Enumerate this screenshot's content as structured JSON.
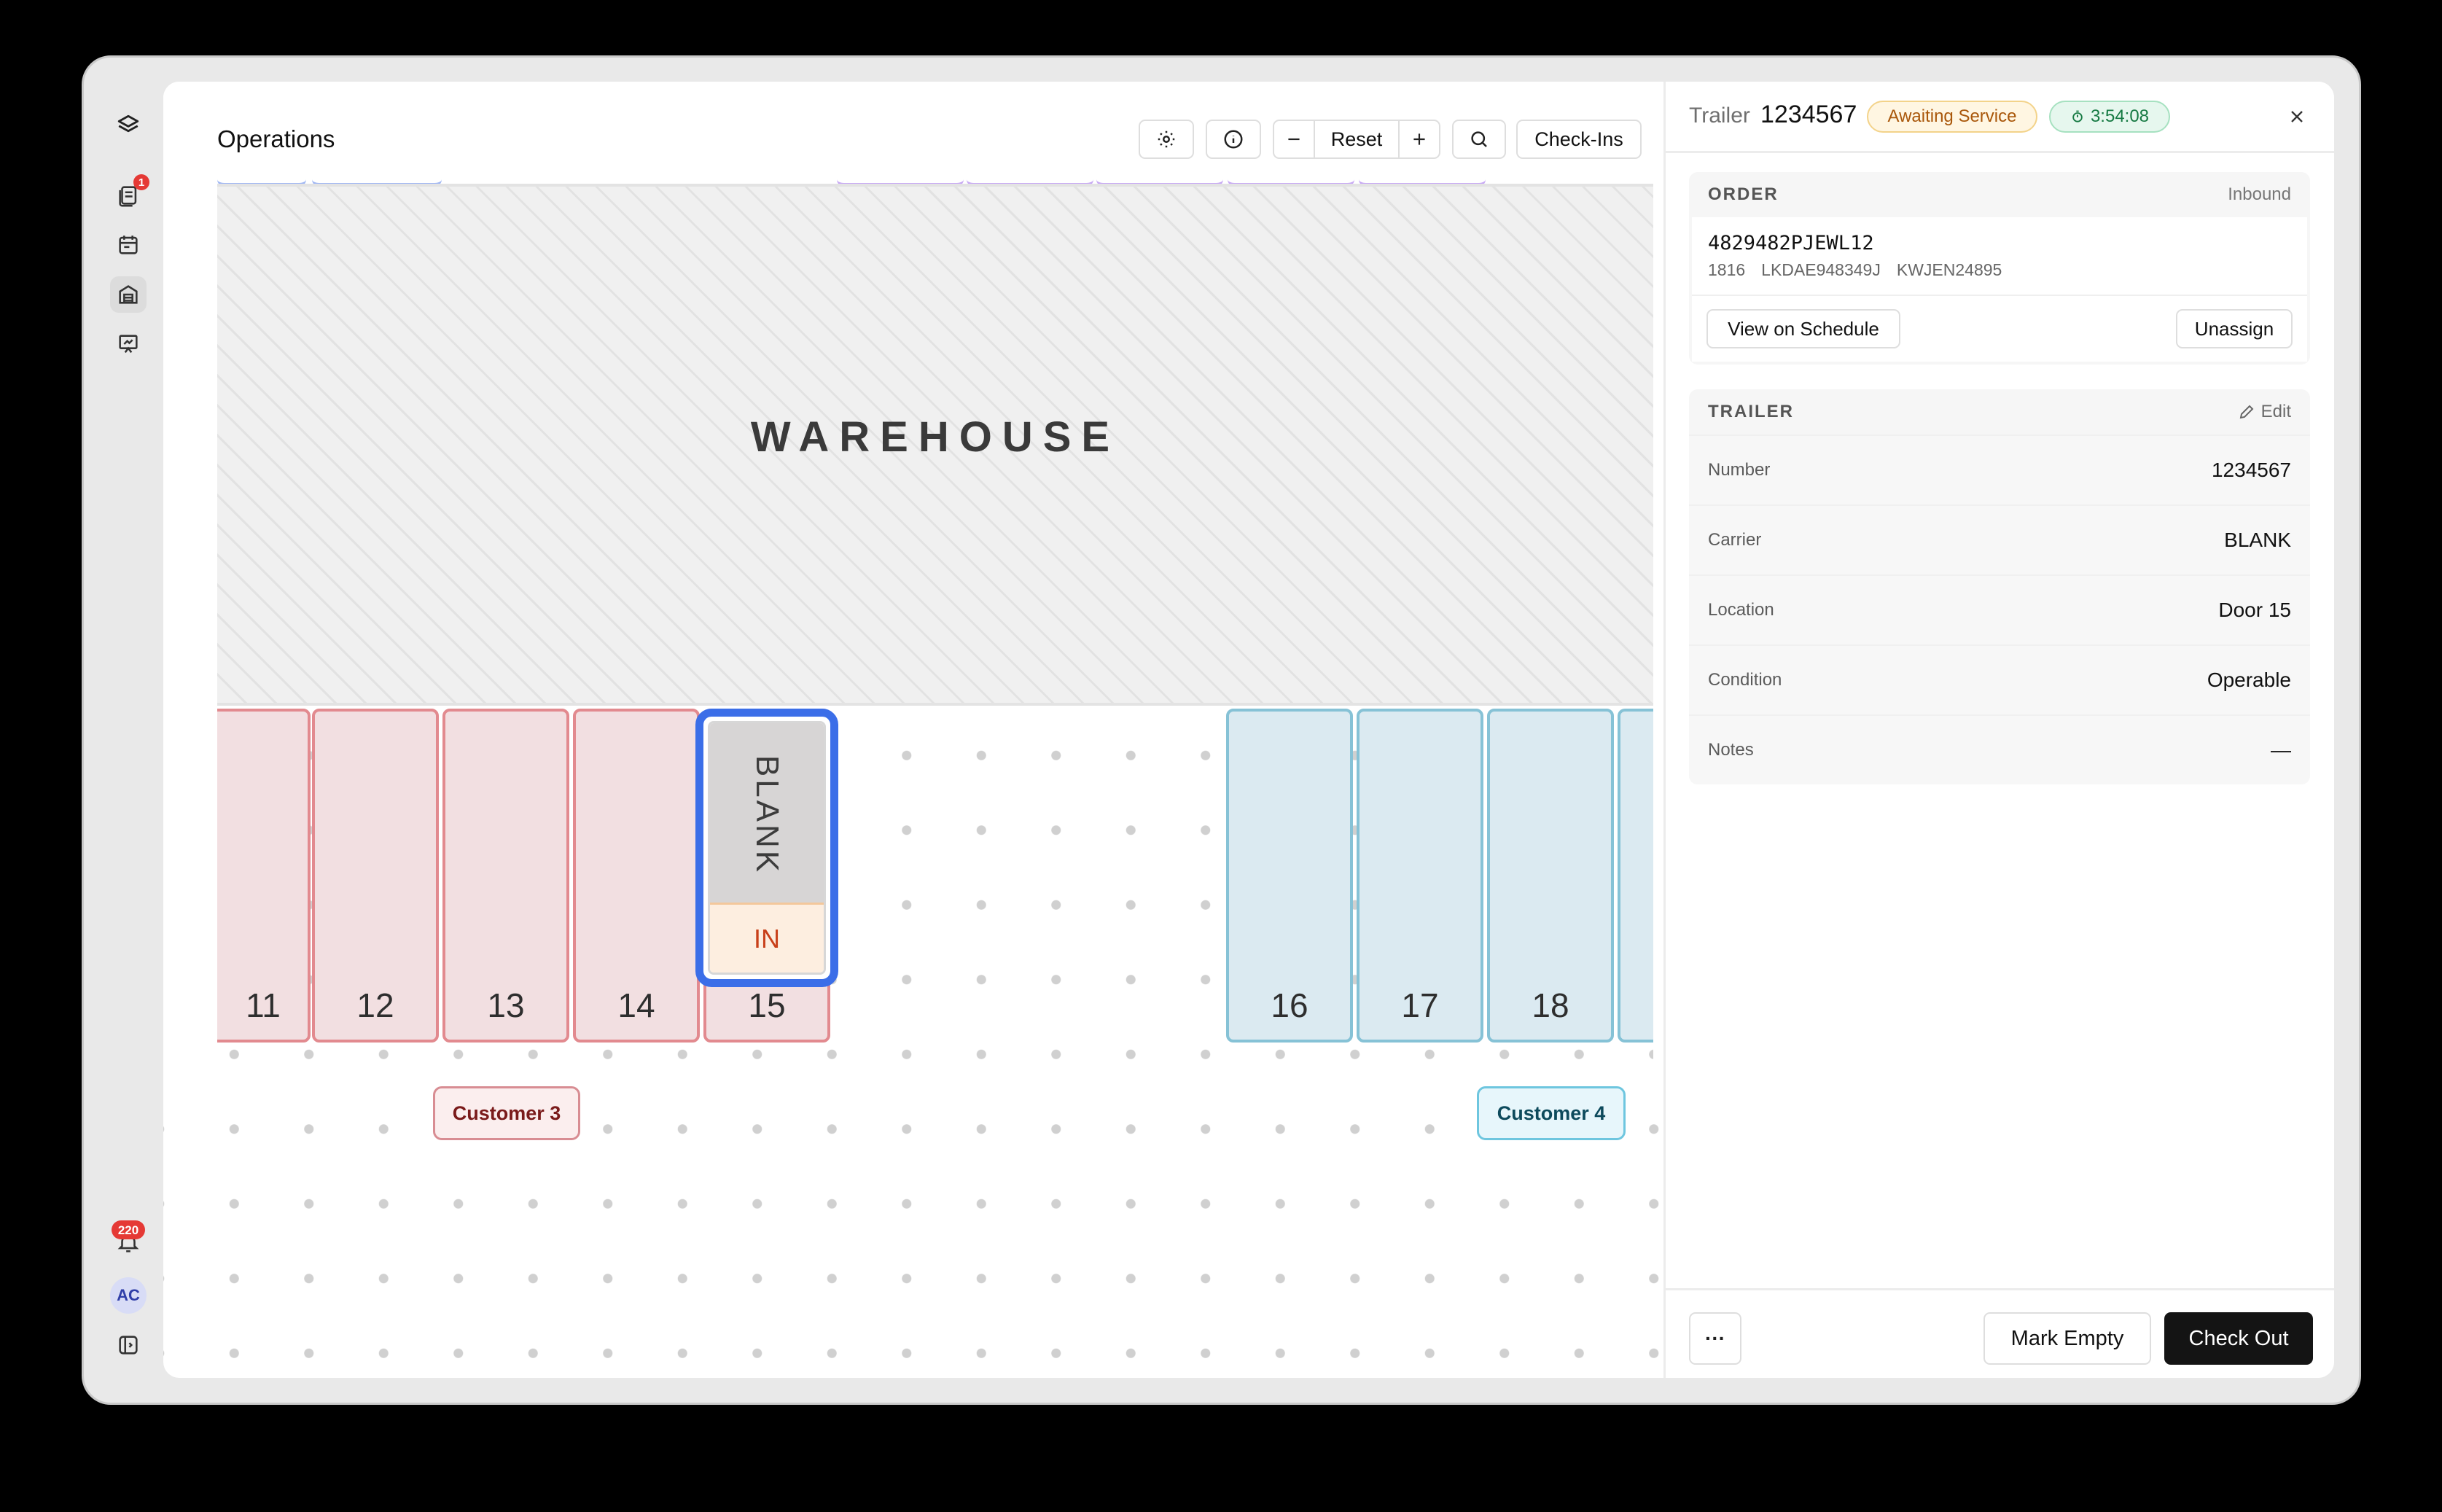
{
  "sidebar": {
    "notifications_badge": "1",
    "alerts_badge": "220",
    "user_initials": "AC"
  },
  "map": {
    "title": "Operations",
    "toolbar": {
      "reset_label": "Reset",
      "checkins_label": "Check-Ins"
    },
    "warehouse_label": "WAREHOUSE",
    "doors": [
      {
        "number": "11",
        "color": "red"
      },
      {
        "number": "12",
        "color": "red"
      },
      {
        "number": "13",
        "color": "red"
      },
      {
        "number": "14",
        "color": "red"
      },
      {
        "number": "15",
        "color": "red"
      },
      {
        "number": "16",
        "color": "blue"
      },
      {
        "number": "17",
        "color": "blue"
      },
      {
        "number": "18",
        "color": "blue"
      }
    ],
    "selected_trailer": {
      "carrier": "BLANK",
      "status": "IN"
    },
    "customers": {
      "left": "Customer 3",
      "right": "Customer 4"
    }
  },
  "panel": {
    "header_label": "Trailer",
    "trailer_number": "1234567",
    "status_pill": "Awaiting Service",
    "timer": "3:54:08",
    "order": {
      "title": "ORDER",
      "direction": "Inbound",
      "id": "4829482PJEWL12",
      "meta": [
        "1816",
        "LKDAE948349J",
        "KWJEN24895"
      ],
      "view_label": "View on Schedule",
      "unassign_label": "Unassign"
    },
    "trailer": {
      "title": "TRAILER",
      "edit_label": "Edit",
      "rows": [
        {
          "key": "Number",
          "value": "1234567"
        },
        {
          "key": "Carrier",
          "value": "BLANK"
        },
        {
          "key": "Location",
          "value": "Door 15"
        },
        {
          "key": "Condition",
          "value": "Operable"
        },
        {
          "key": "Notes",
          "value": "—"
        }
      ]
    },
    "footer": {
      "more_label": "···",
      "mark_empty_label": "Mark Empty",
      "checkout_label": "Check Out"
    }
  },
  "colors": {
    "accent": "#3b6ee8",
    "door_red": "#f2dfe1",
    "door_blue": "#dbeaf1",
    "amber": "#a9570a",
    "green": "#167a43"
  }
}
